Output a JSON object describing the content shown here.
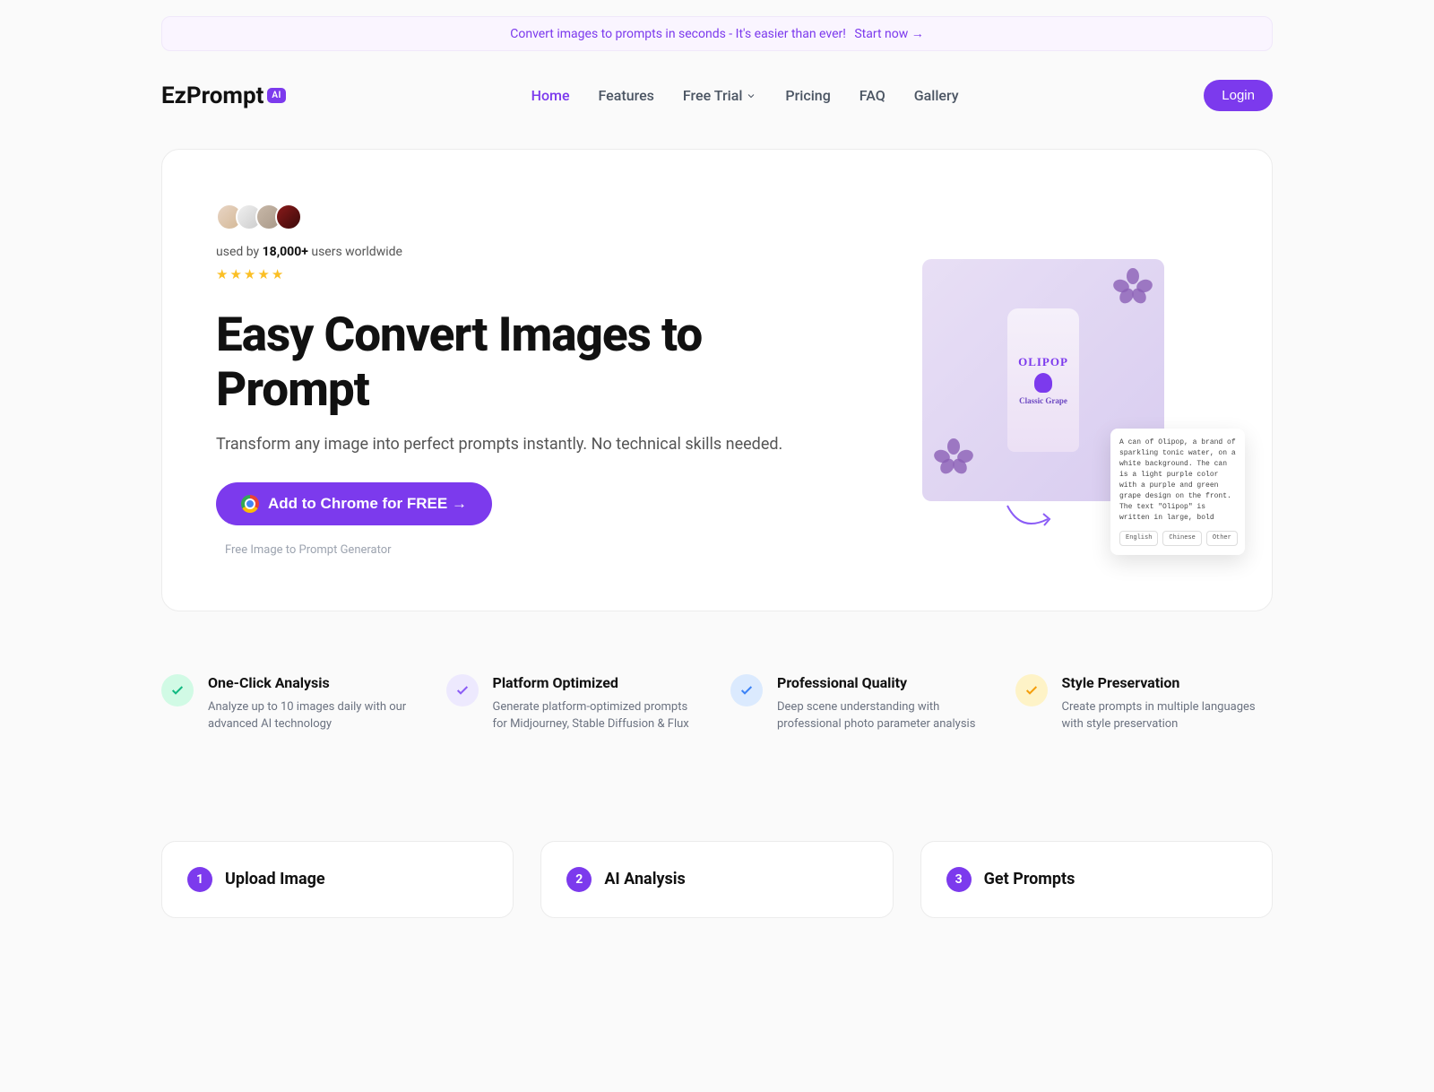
{
  "banner": {
    "text": "Convert images to prompts in seconds - It's easier than ever!",
    "cta": "Start now →"
  },
  "logo": {
    "text": "EzPrompt",
    "badge": "AI"
  },
  "nav": {
    "home": "Home",
    "features": "Features",
    "free_trial": "Free Trial",
    "pricing": "Pricing",
    "faq": "FAQ",
    "gallery": "Gallery"
  },
  "login": "Login",
  "hero": {
    "used_by_prefix": "used by ",
    "used_by_count": "18,000+",
    "used_by_suffix": " users worldwide",
    "title": "Easy Convert Images to Prompt",
    "subtitle": "Transform any image into perfect prompts instantly. No technical skills needed.",
    "cta": "Add to Chrome for FREE →",
    "note": "Free Image to Prompt Generator"
  },
  "demo_image": {
    "brand": "OLIPOP",
    "flavor": "Classic Grape"
  },
  "prompt_preview": {
    "text": "A can of Olipop, a brand of sparkling tonic water, on a white background. The can is a light purple color with a purple and green grape design on the front. The text \"Olipop\" is written in large, bold",
    "langs": [
      "English",
      "Chinese",
      "Other"
    ]
  },
  "features": [
    {
      "title": "One-Click Analysis",
      "desc": "Analyze up to 10 images daily with our advanced AI technology",
      "color": "green"
    },
    {
      "title": "Platform Optimized",
      "desc": "Generate platform-optimized prompts for Midjourney, Stable Diffusion & Flux",
      "color": "purple"
    },
    {
      "title": "Professional Quality",
      "desc": "Deep scene understanding with professional photo parameter analysis",
      "color": "blue"
    },
    {
      "title": "Style Preservation",
      "desc": "Create prompts in multiple languages with style preservation",
      "color": "yellow"
    }
  ],
  "steps": [
    {
      "num": "1",
      "title": "Upload Image"
    },
    {
      "num": "2",
      "title": "AI Analysis"
    },
    {
      "num": "3",
      "title": "Get Prompts"
    }
  ]
}
